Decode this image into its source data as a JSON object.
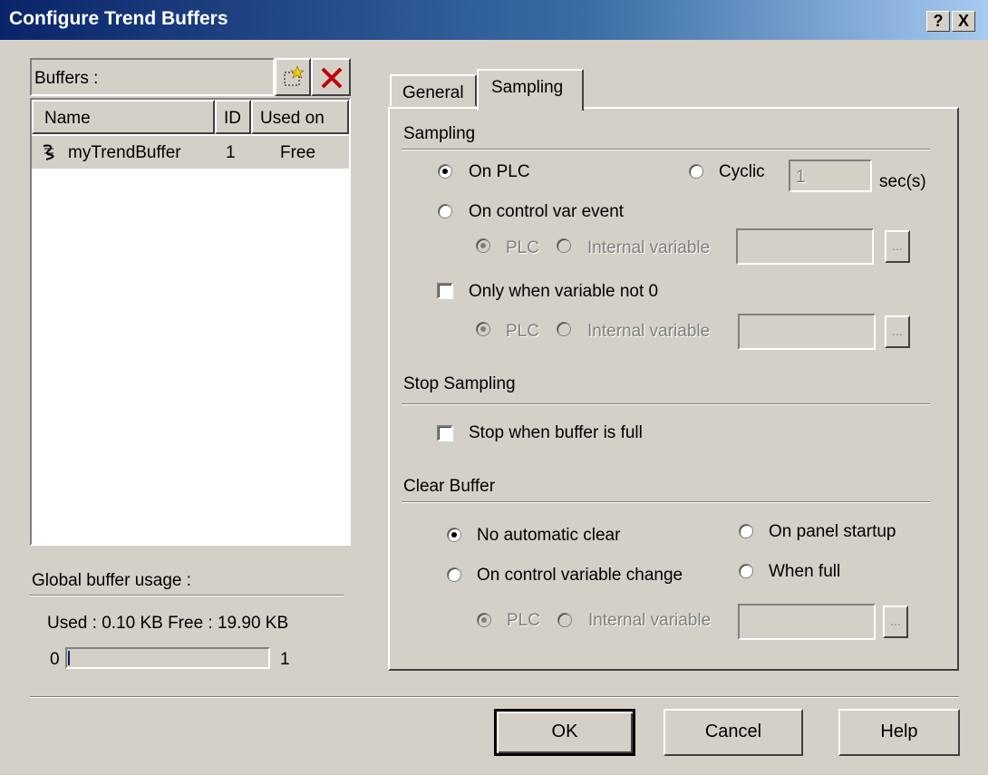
{
  "window": {
    "title": "Configure Trend Buffers",
    "help_label": "?",
    "close_label": "X"
  },
  "buffers": {
    "label": "Buffers :",
    "columns": [
      "Name",
      "ID",
      "Used on"
    ],
    "rows": [
      {
        "name": "myTrendBuffer",
        "id": "1",
        "used_on": "Free"
      }
    ],
    "add_icon": "new-buffer-icon",
    "delete_icon": "delete-x-icon"
  },
  "usage": {
    "label": "Global buffer usage :",
    "text": "Used : 0.10 KB  Free : 19.90 KB",
    "min": "0",
    "max": "1",
    "fraction": 0.005
  },
  "tabs": [
    {
      "label": "General",
      "active": false
    },
    {
      "label": "Sampling",
      "active": true
    }
  ],
  "sampling": {
    "header": "Sampling",
    "on_plc": "On PLC",
    "cyclic": "Cyclic",
    "cyclic_value": "1",
    "cyclic_unit": "sec(s)",
    "on_control_var": "On control var event",
    "plc": "PLC",
    "internal_variable": "Internal variable",
    "only_when_not0": "Only when variable not 0",
    "ellipsis": "..."
  },
  "stop_sampling": {
    "header": "Stop Sampling",
    "stop_when_full": "Stop when buffer is full"
  },
  "clear_buffer": {
    "header": "Clear Buffer",
    "no_auto_clear": "No automatic clear",
    "on_panel_startup": "On panel startup",
    "on_control_var_change": "On control variable change",
    "when_full": "When full",
    "plc": "PLC",
    "internal_variable": "Internal variable",
    "ellipsis": "..."
  },
  "buttons": {
    "ok": "OK",
    "cancel": "Cancel",
    "help": "Help"
  }
}
